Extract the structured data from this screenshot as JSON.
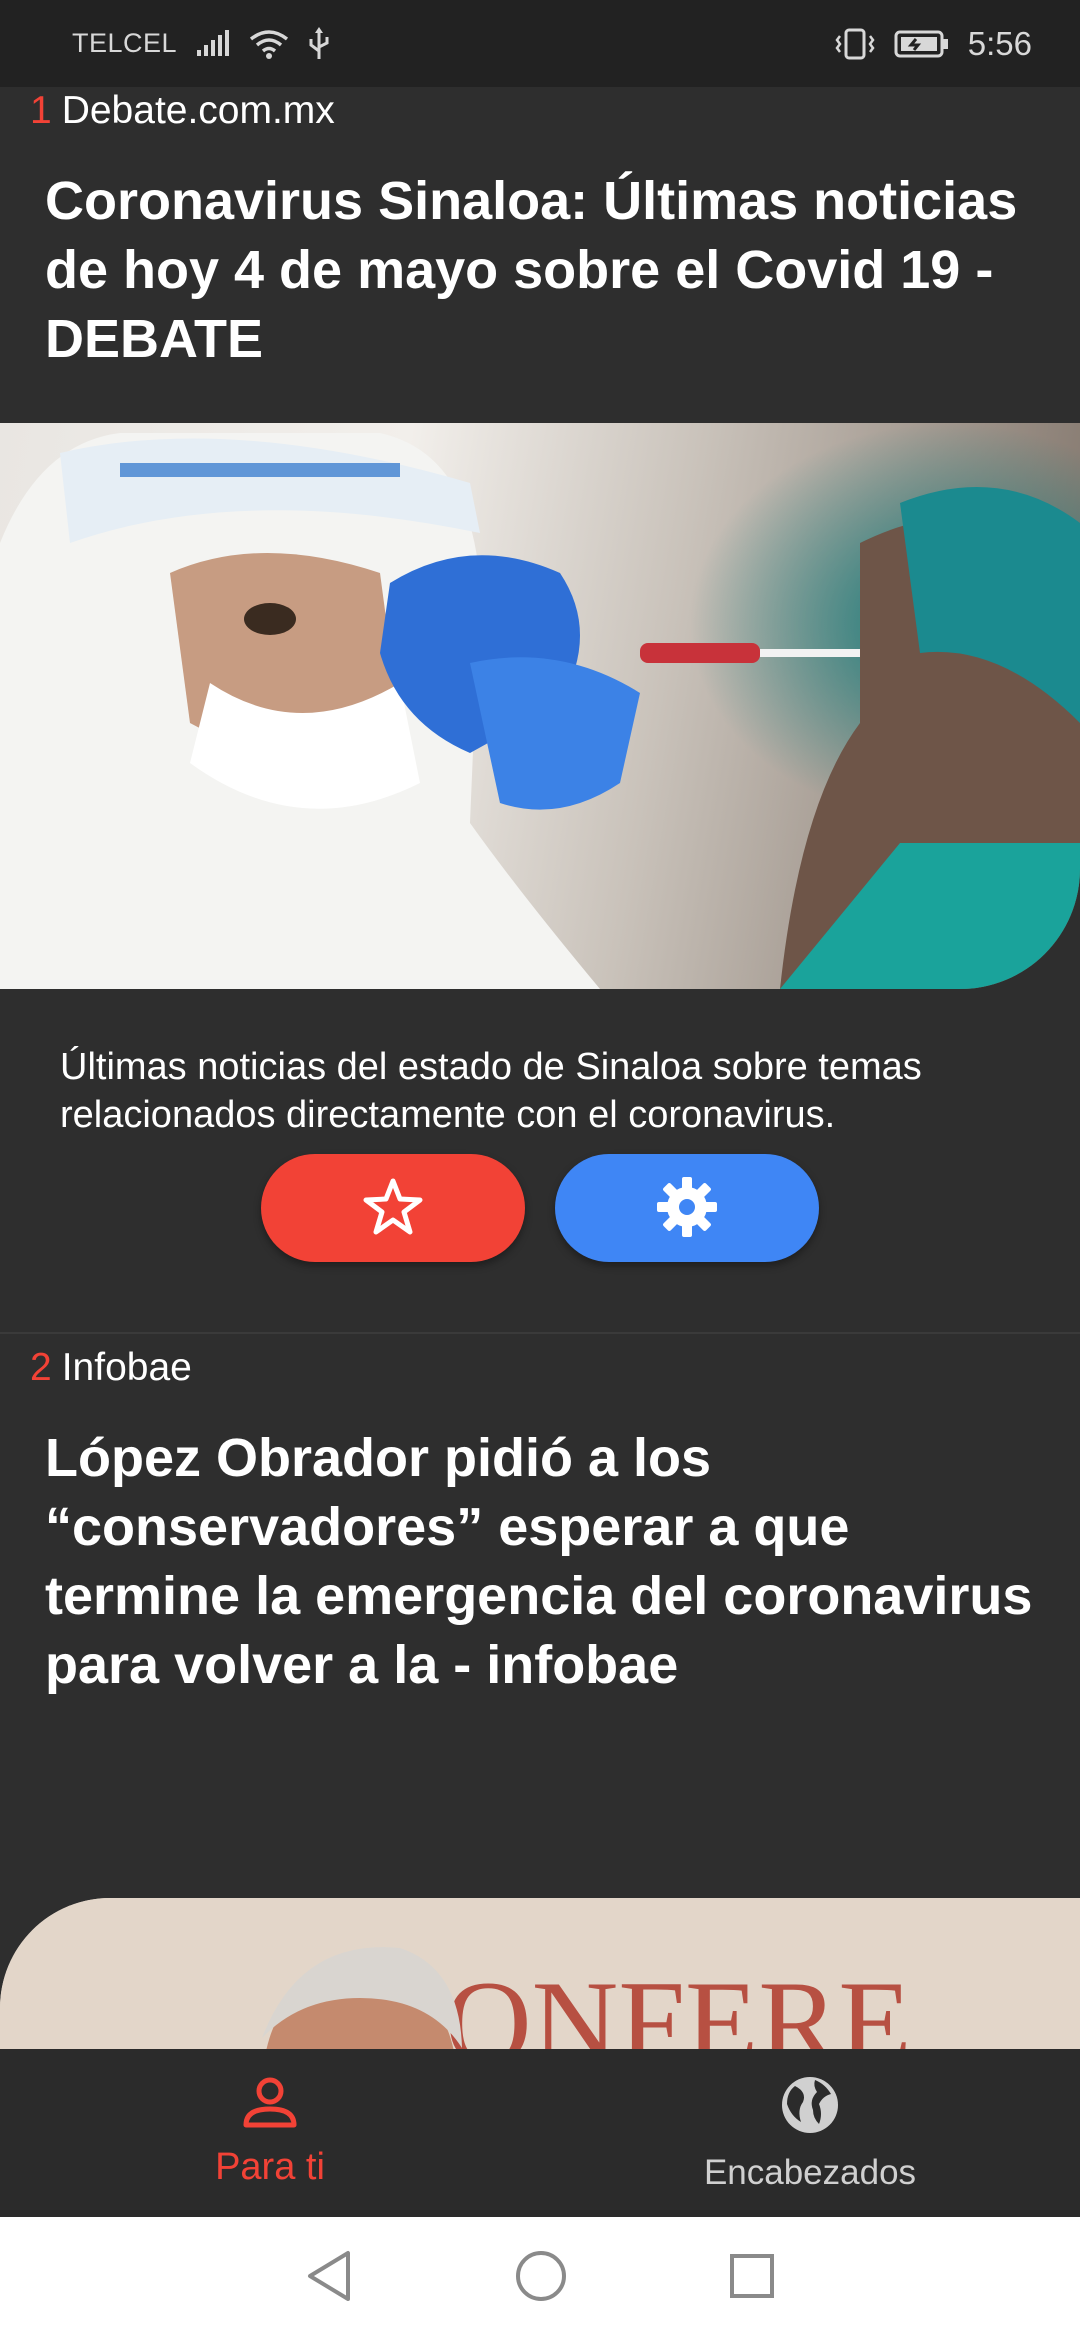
{
  "status_bar": {
    "carrier": "TELCEL",
    "time": "5:56",
    "icons": [
      "signal-icon",
      "wifi-icon",
      "usb-icon",
      "vibrate-icon",
      "battery-charging-icon"
    ]
  },
  "articles": [
    {
      "number": "1",
      "source": "Debate.com.mx",
      "headline": "Coronavirus Sinaloa: Últimas noticias de hoy 4 de mayo sobre el Covid 19 - DEBATE",
      "summary": "Últimas noticias del estado de Sinaloa sobre temas relacionados directamente con el coronavirus.",
      "actions": [
        "star-icon",
        "gear-icon"
      ]
    },
    {
      "number": "2",
      "source": "Infobae",
      "headline": "López Obrador pidió a los “conservadores” esperar a que termine la emergencia del coronavirus para volver a la - infobae",
      "image_text": "ONFERE"
    }
  ],
  "bottom_nav": {
    "items": [
      {
        "label": "Para ti",
        "icon": "person-icon",
        "active": true
      },
      {
        "label": "Encabezados",
        "icon": "globe-icon",
        "active": false
      }
    ]
  },
  "system_nav": [
    "back-icon",
    "home-icon",
    "recents-icon"
  ],
  "colors": {
    "accent_red": "#f24236",
    "accent_blue": "#3f86f5",
    "background": "#2e2e2e"
  }
}
